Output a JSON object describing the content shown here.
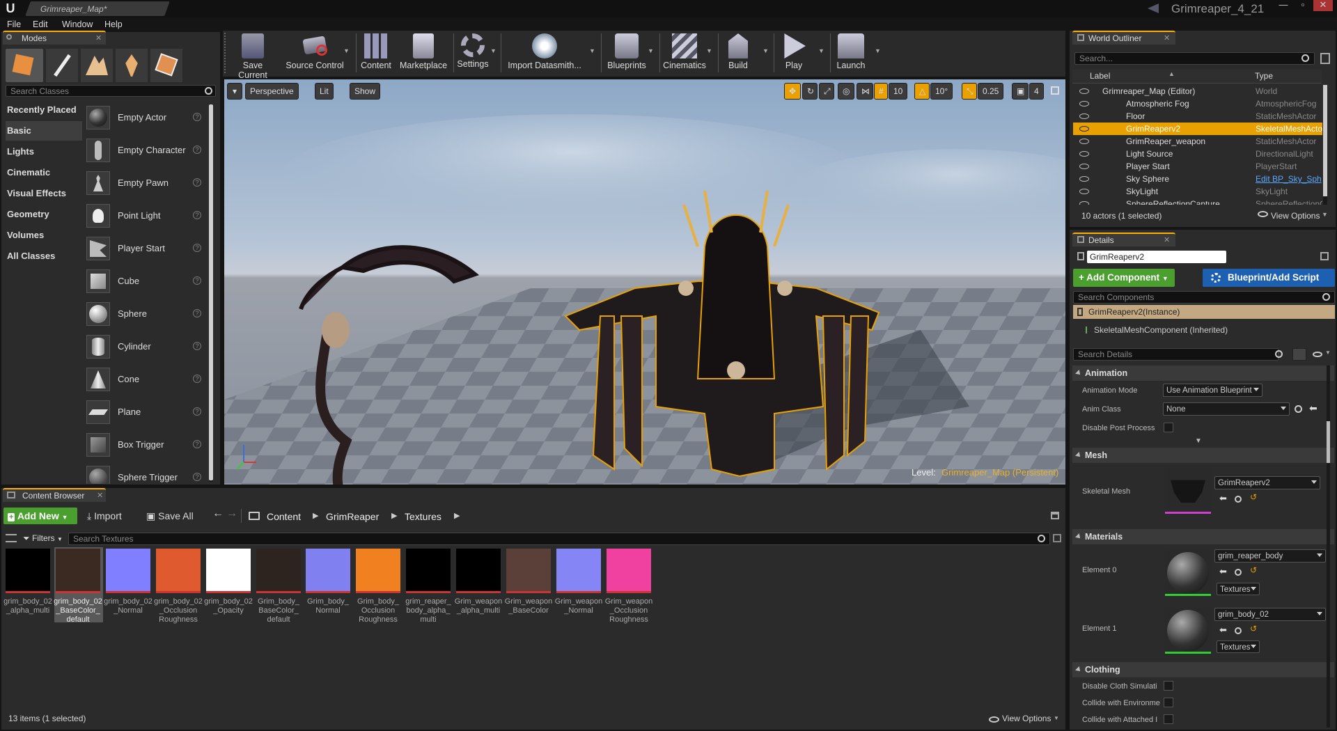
{
  "titlebar": {
    "tab_title": "Grimreaper_Map*",
    "project_name": "Grimreaper_4_21",
    "logo": "U"
  },
  "window_controls": {
    "minimize": "—",
    "maximize": "▫",
    "close": "✕"
  },
  "menu": [
    "File",
    "Edit",
    "Window",
    "Help"
  ],
  "modes": {
    "tab": "Modes",
    "search_placeholder": "Search Classes",
    "categories": [
      "Recently Placed",
      "Basic",
      "Lights",
      "Cinematic",
      "Visual Effects",
      "Geometry",
      "Volumes",
      "All Classes"
    ],
    "selected_category": "Basic",
    "items": [
      "Empty Actor",
      "Empty Character",
      "Empty Pawn",
      "Point Light",
      "Player Start",
      "Cube",
      "Sphere",
      "Cylinder",
      "Cone",
      "Plane",
      "Box Trigger",
      "Sphere Trigger"
    ]
  },
  "toolbar": {
    "buttons": [
      "Save Current",
      "Source Control",
      "Content",
      "Marketplace",
      "Settings",
      "Import Datasmith...",
      "Blueprints",
      "Cinematics",
      "Build",
      "Play",
      "Launch"
    ]
  },
  "viewport": {
    "perspective": "Perspective",
    "lit": "Lit",
    "show": "Show",
    "grid_snap": "10",
    "rotation_snap": "10°",
    "scale_snap": "0.25",
    "camera_speed": "4",
    "level_label": "Level:",
    "level_name": "Grimreaper_Map (Persistent)"
  },
  "outliner": {
    "tab": "World Outliner",
    "search_placeholder": "Search...",
    "col_label": "Label",
    "col_type": "Type",
    "rows": [
      {
        "label": "Grimreaper_Map (Editor)",
        "type": "World"
      },
      {
        "label": "Atmospheric Fog",
        "type": "AtmosphericFog"
      },
      {
        "label": "Floor",
        "type": "StaticMeshActor"
      },
      {
        "label": "GrimReaperv2",
        "type": "SkeletalMeshActo"
      },
      {
        "label": "GrimReaper_weapon",
        "type": "StaticMeshActor"
      },
      {
        "label": "Light Source",
        "type": "DirectionalLight"
      },
      {
        "label": "Player Start",
        "type": "PlayerStart"
      },
      {
        "label": "Sky Sphere",
        "type": "Edit BP_Sky_Sph"
      },
      {
        "label": "SkyLight",
        "type": "SkyLight"
      },
      {
        "label": "SphereReflectionCapture",
        "type": "SphereReflectionC"
      }
    ],
    "status": "10 actors (1 selected)",
    "view_options": "View Options"
  },
  "details": {
    "tab": "Details",
    "name_value": "GrimReaperv2",
    "add_component": "+ Add Component",
    "blueprint_button": "Blueprint/Add Script",
    "search_components_placeholder": "Search Components",
    "instance": "GrimReaperv2(Instance)",
    "component": "SkeletalMeshComponent (Inherited)",
    "search_details_placeholder": "Search Details",
    "animation": {
      "section": "Animation",
      "mode_label": "Animation Mode",
      "mode_value": "Use Animation Blueprint",
      "class_label": "Anim Class",
      "class_value": "None",
      "disable_post_label": "Disable Post Process"
    },
    "mesh": {
      "section": "Mesh",
      "label": "Skeletal Mesh",
      "value": "GrimReaperv2"
    },
    "materials": {
      "section": "Materials",
      "elements": [
        {
          "label": "Element 0",
          "value": "grim_reaper_body",
          "filter": "Textures"
        },
        {
          "label": "Element 1",
          "value": "grim_body_02",
          "filter": "Textures"
        }
      ]
    },
    "clothing": {
      "section": "Clothing",
      "rows": [
        "Disable Cloth Simulati",
        "Collide with Environme",
        "Collide with Attached I"
      ]
    }
  },
  "content_browser": {
    "tab": "Content Browser",
    "add_new": "Add New",
    "import": "Import",
    "save_all": "Save All",
    "breadcrumb": [
      "Content",
      "GrimReaper",
      "Textures"
    ],
    "filters": "Filters",
    "search_placeholder": "Search Textures",
    "assets": [
      {
        "name": "grim_body_02\n_alpha_multi",
        "color": "#000000"
      },
      {
        "name": "grim_body_02\n_BaseColor_\ndefault",
        "color": "#3a2a22"
      },
      {
        "name": "grim_body_02\n_Normal",
        "color": "#7f7fff"
      },
      {
        "name": "grim_body_02\n_Occlusion\nRoughness",
        "color": "#e05a30"
      },
      {
        "name": "grim_body_02\n_Opacity",
        "color": "#ffffff"
      },
      {
        "name": "Grim_body_\nBaseColor_\ndefault",
        "color": "#2e241f"
      },
      {
        "name": "Grim_body_\nNormal",
        "color": "#8080f0"
      },
      {
        "name": "Grim_body_\nOcclusion\nRoughness",
        "color": "#f08020"
      },
      {
        "name": "grim_reaper_\nbody_alpha_\nmulti",
        "color": "#000000"
      },
      {
        "name": "Grim_weapon\n_alpha_multi",
        "color": "#000000"
      },
      {
        "name": "Grim_weapon\n_BaseColor",
        "color": "#5a4038"
      },
      {
        "name": "Grim_weapon\n_Normal",
        "color": "#8585f5"
      },
      {
        "name": "Grim_weapon\n_Occlusion\nRoughness",
        "color": "#f040a0"
      }
    ],
    "status": "13 items (1 selected)",
    "view_options": "View Options"
  },
  "colors": {
    "accent": "#ffb000",
    "select": "#e8a100",
    "add_green": "#4a9f2e",
    "blueprint_blue": "#1d5fb0"
  }
}
